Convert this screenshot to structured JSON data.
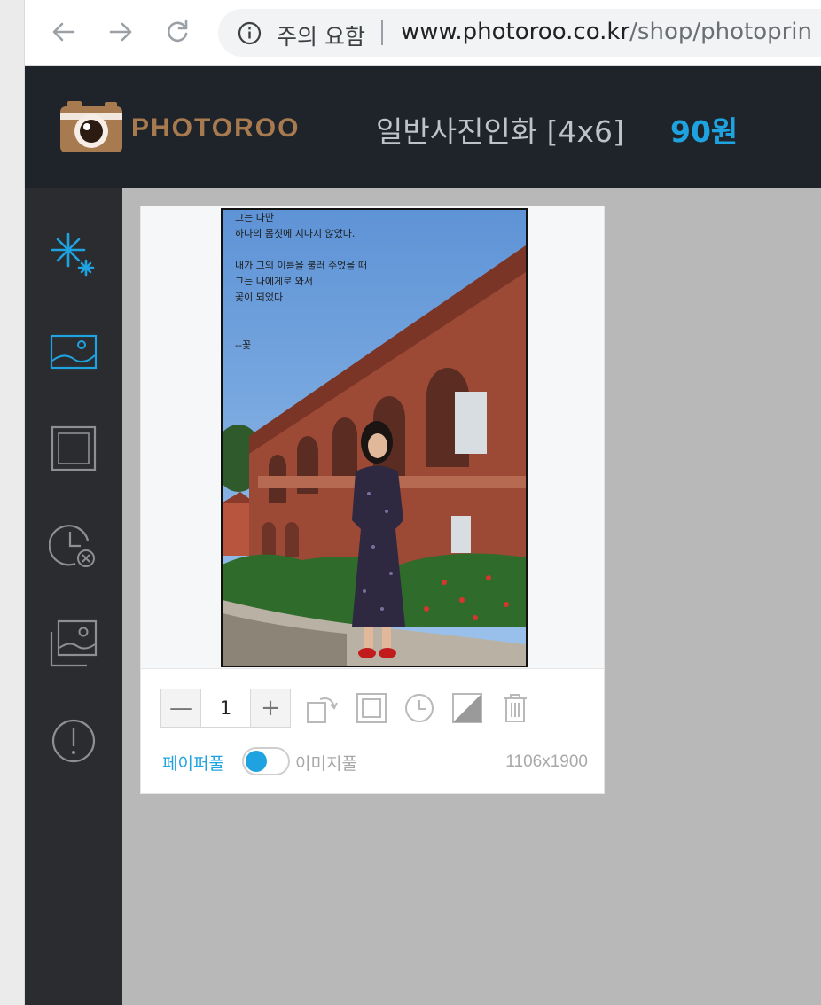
{
  "browser": {
    "security_label": "주의 요함",
    "url_host": "www.photoroo.co.kr",
    "url_path": "/shop/photoprin"
  },
  "header": {
    "logo_text": "PHOTOROO",
    "product_title": "일반사진인화 [4x6]",
    "price": "90원"
  },
  "sidebar": {
    "items": [
      {
        "icon": "sparkle-icon",
        "active": true
      },
      {
        "icon": "image-frame-icon",
        "active": true
      },
      {
        "icon": "border-frame-icon",
        "active": false
      },
      {
        "icon": "date-remove-icon",
        "active": false
      },
      {
        "icon": "gallery-icon",
        "active": false
      },
      {
        "icon": "alert-icon",
        "active": false
      }
    ]
  },
  "card": {
    "photo_text": "그는 다만\n하나의 몸짓에 지나지 않았다.\n\n내가 그의 이름을 불러 주었을 때\n그는 나에게로 와서\n꽃이 되었다\n\n\n--꽃",
    "quantity": "1",
    "minus_label": "—",
    "plus_label": "+",
    "paper_fill_label": "페이퍼풀",
    "image_fill_label": "이미지풀",
    "dimensions": "1106x1900"
  },
  "colors": {
    "accent": "#1fa3e0",
    "header_bg": "#1f232a",
    "sidebar_bg": "#2a2c30",
    "canvas_bg": "#b8b8b8",
    "logo_brown": "#a87a4f"
  }
}
